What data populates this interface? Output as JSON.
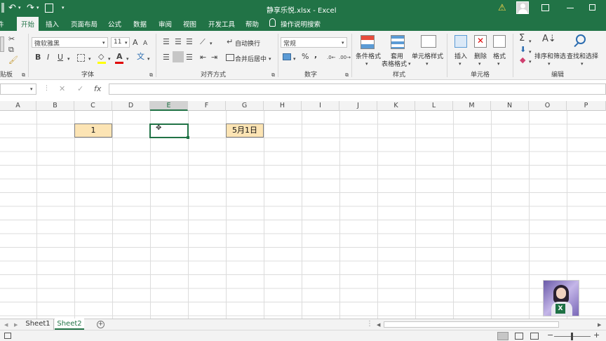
{
  "titlebar": {
    "filename": "静享乐悦.xlsx",
    "separator": "-",
    "app": "Excel",
    "warning_icon": "warning-icon",
    "account_icon": "user-avatar-icon",
    "quick_access": [
      "undo-icon",
      "redo-icon",
      "print-preview-icon",
      "customize-icon"
    ]
  },
  "menu": {
    "items": [
      {
        "label": "件"
      },
      {
        "label": "开始"
      },
      {
        "label": "插入"
      },
      {
        "label": "页面布局"
      },
      {
        "label": "公式"
      },
      {
        "label": "数据"
      },
      {
        "label": "审阅"
      },
      {
        "label": "视图"
      },
      {
        "label": "开发工具"
      },
      {
        "label": "帮助"
      }
    ],
    "search": "操作说明搜索"
  },
  "ribbon": {
    "clipboard_label": "贴板",
    "font": {
      "name": "微软雅黑",
      "size": "11",
      "bold": "B",
      "italic": "I",
      "underline": "U",
      "grow": "A",
      "shrink": "A",
      "color": "A",
      "label": "字体"
    },
    "align": {
      "wrap": "自动换行",
      "merge": "合并后居中",
      "label": "对齐方式"
    },
    "number": {
      "format": "常规",
      "label": "数字",
      "percent": "%",
      "comma": ","
    },
    "styles": {
      "conditional": "条件格式",
      "table_line1": "套用",
      "table_line2": "表格格式",
      "cell_styles": "单元格样式",
      "label": "样式"
    },
    "cells": {
      "insert": "插入",
      "delete": "删除",
      "format": "格式",
      "label": "单元格"
    },
    "editing": {
      "sort_filter": "排序和筛选",
      "find_select": "查找和选择",
      "label": "编辑"
    }
  },
  "formula_bar": {
    "fx": "fx",
    "cancel": "✕",
    "confirm": "✓",
    "value": ""
  },
  "columns": [
    "A",
    "B",
    "C",
    "D",
    "E",
    "F",
    "G",
    "H",
    "I",
    "J",
    "K",
    "L",
    "M",
    "N",
    "O",
    "P"
  ],
  "active_column": "E",
  "cells": {
    "c_value": "1",
    "g_value": "5月1日"
  },
  "sheets": [
    {
      "name": "Sheet1",
      "active": false
    },
    {
      "name": "Sheet2",
      "active": true
    }
  ],
  "colors": {
    "accent": "#217346",
    "highlight_fill": "#fce4b4",
    "header_bg": "#f3f3f3"
  }
}
